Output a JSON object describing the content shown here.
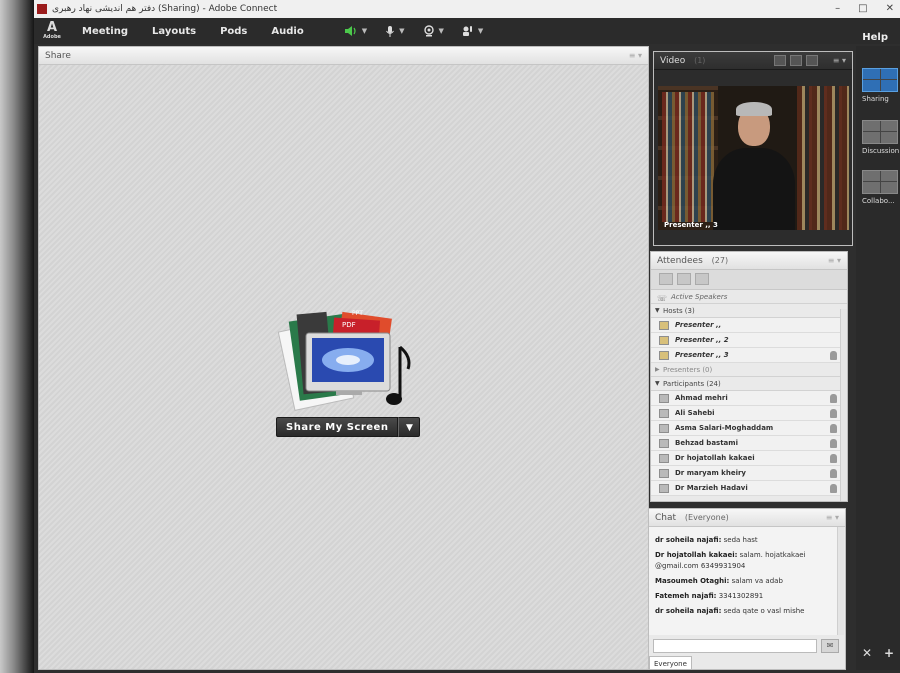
{
  "window": {
    "title": "دفتر هم اندیشی نهاد رهبری (Sharing) - Adobe Connect"
  },
  "brand": {
    "logo_glyph": "A",
    "logo_text": "Adobe"
  },
  "menu": {
    "items": [
      "Meeting",
      "Layouts",
      "Pods",
      "Audio"
    ],
    "help": "Help"
  },
  "share_pod": {
    "title": "Share",
    "share_button": "Share My Screen"
  },
  "video_pod": {
    "title": "Video",
    "count": "(1)",
    "caption": "Presenter ,, 3"
  },
  "attendees_pod": {
    "title": "Attendees",
    "count": "(27)",
    "active_speakers": "Active Speakers",
    "hosts_header": "Hosts (3)",
    "hosts": [
      "Presenter ,,",
      "Presenter ,, 2",
      "Presenter ,, 3"
    ],
    "presenters_header": "Presenters (0)",
    "participants_header": "Participants (24)",
    "participants": [
      "Ahmad mehri",
      "Ali Sahebi",
      "Asma Salari-Moghaddam",
      "Behzad bastami",
      "Dr hojatollah kakaei",
      "Dr maryam kheiry",
      "Dr Marzieh Hadavi"
    ]
  },
  "chat_pod": {
    "title": "Chat",
    "scope": "(Everyone)",
    "messages": [
      {
        "sender": "dr soheila najafi:",
        "text": "seda hast"
      },
      {
        "sender": "Dr hojatollah kakaei:",
        "text": "salam.  hojatkakaei @gmail.com 6349931904"
      },
      {
        "sender": "Masoumeh Otaghi:",
        "text": "salam va adab"
      },
      {
        "sender": "Fatemeh najafi:",
        "text": "3341302891"
      },
      {
        "sender": "dr soheila najafi:",
        "text": "seda qate o vasl mishe"
      }
    ],
    "tab": "Everyone"
  },
  "layouts": {
    "items": [
      "Sharing",
      "Discussion",
      "Collabo..."
    ],
    "active": "Sharing"
  },
  "colors": {
    "accent": "#2f6fb5",
    "menubar": "#2b2b2b",
    "audio_on": "#4cc94c"
  }
}
